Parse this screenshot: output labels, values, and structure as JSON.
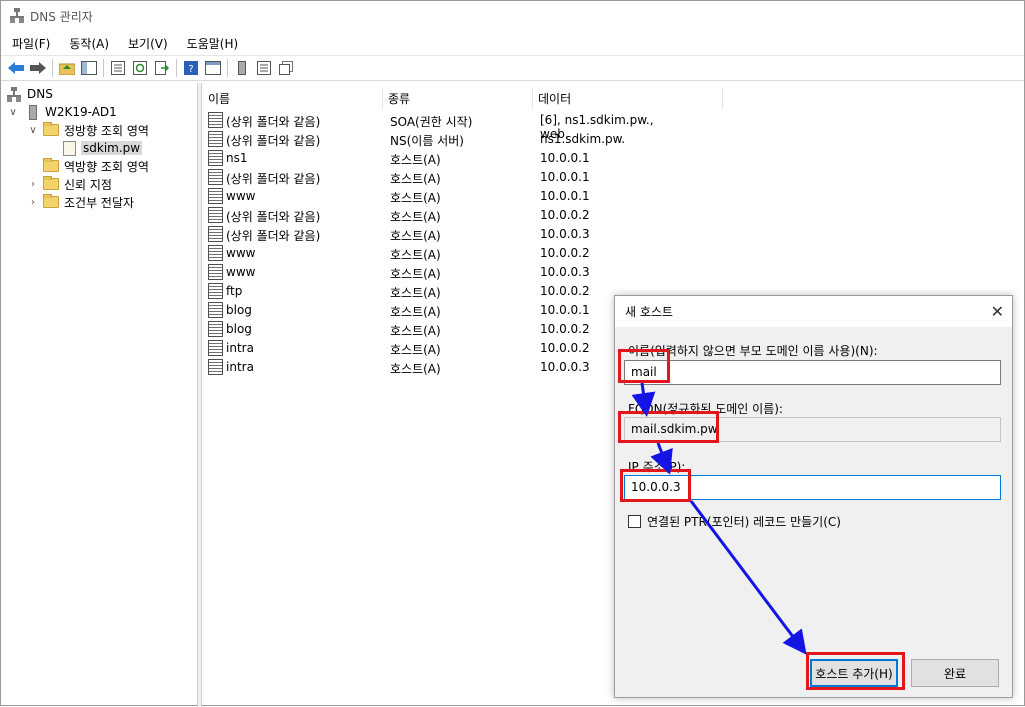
{
  "window": {
    "title": "DNS 관리자"
  },
  "menu": [
    "파일(F)",
    "동작(A)",
    "보기(V)",
    "도움말(H)"
  ],
  "tree": {
    "root": "DNS",
    "server": "W2K19-AD1",
    "forward_zones": "정방향 조회 영역",
    "zone": "sdkim.pw",
    "reverse_zones": "역방향 조회 영역",
    "trust_points": "신뢰 지점",
    "conditional_forwarders": "조건부 전달자"
  },
  "list": {
    "headers": {
      "name": "이름",
      "type": "종류",
      "data": "데이터"
    },
    "rows": [
      {
        "name": "(상위 폴더와 같음)",
        "type": "SOA(권한 시작)",
        "data": "[6], ns1.sdkim.pw., web."
      },
      {
        "name": "(상위 폴더와 같음)",
        "type": "NS(이름 서버)",
        "data": "ns1.sdkim.pw."
      },
      {
        "name": "ns1",
        "type": "호스트(A)",
        "data": "10.0.0.1"
      },
      {
        "name": "(상위 폴더와 같음)",
        "type": "호스트(A)",
        "data": "10.0.0.1"
      },
      {
        "name": "www",
        "type": "호스트(A)",
        "data": "10.0.0.1"
      },
      {
        "name": "(상위 폴더와 같음)",
        "type": "호스트(A)",
        "data": "10.0.0.2"
      },
      {
        "name": "(상위 폴더와 같음)",
        "type": "호스트(A)",
        "data": "10.0.0.3"
      },
      {
        "name": "www",
        "type": "호스트(A)",
        "data": "10.0.0.2"
      },
      {
        "name": "www",
        "type": "호스트(A)",
        "data": "10.0.0.3"
      },
      {
        "name": "ftp",
        "type": "호스트(A)",
        "data": "10.0.0.2"
      },
      {
        "name": "blog",
        "type": "호스트(A)",
        "data": "10.0.0.1"
      },
      {
        "name": "blog",
        "type": "호스트(A)",
        "data": "10.0.0.2"
      },
      {
        "name": "intra",
        "type": "호스트(A)",
        "data": "10.0.0.2"
      },
      {
        "name": "intra",
        "type": "호스트(A)",
        "data": "10.0.0.3"
      }
    ]
  },
  "dialog": {
    "title": "새 호스트",
    "name_label": "이름(입력하지 않으면 부모 도메인 이름 사용)(N):",
    "name_value": "mail",
    "fqdn_label": "FQDN(정규화된 도메인 이름):",
    "fqdn_value": "mail.sdkim.pw.",
    "ip_label": "IP 주소(P):",
    "ip_value": "10.0.0.3",
    "ptr_label": "연결된 PTR(포인터) 레코드 만들기(C)",
    "add_button": "호스트 추가(H)",
    "done_button": "완료"
  },
  "colors": {
    "highlight": "#e3161c",
    "arrow": "#1414e6",
    "accent": "#0078d7"
  }
}
